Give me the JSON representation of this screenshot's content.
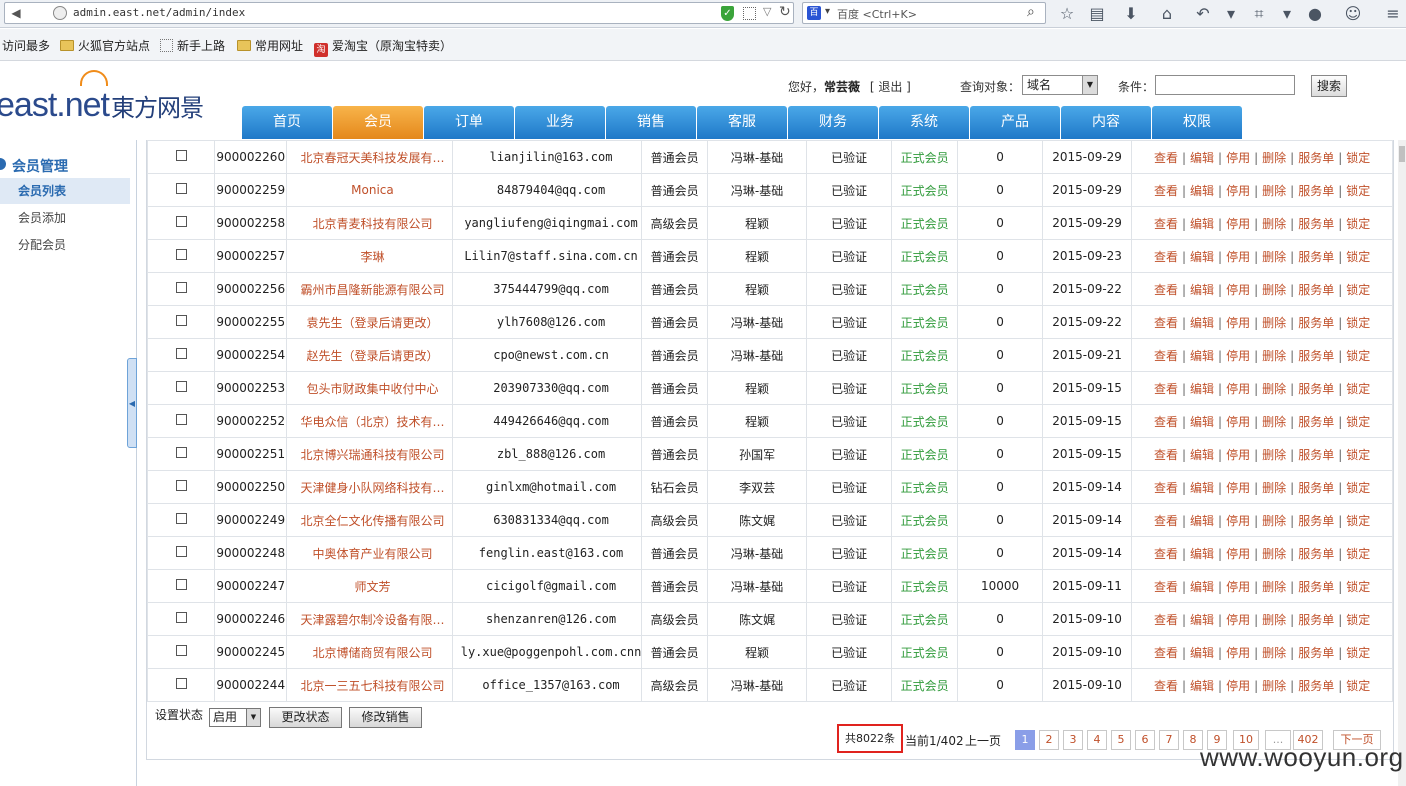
{
  "browser": {
    "url": "admin.east.net/admin/index",
    "search_placeholder": "百度 <Ctrl+K>",
    "bookmarks": [
      "访问最多",
      "火狐官方站点",
      "新手上路",
      "常用网址",
      "爱淘宝（原淘宝特卖）"
    ]
  },
  "header": {
    "logo_text": "east.net",
    "logo_cn": "東方网景",
    "greeting_prefix": "您好，",
    "user_name": "常芸薇",
    "logout": "[ 退出 ]",
    "query_label": "查询对象：",
    "query_value": "域名",
    "cond_label": "条件：",
    "search_button": "搜索"
  },
  "nav": [
    "首页",
    "会员",
    "订单",
    "业务",
    "销售",
    "客服",
    "财务",
    "系统",
    "产品",
    "内容",
    "权限"
  ],
  "nav_active": "会员",
  "sidebar": {
    "title": "会员管理",
    "items": [
      "会员列表",
      "会员添加",
      "分配会员"
    ]
  },
  "ops": [
    "查看",
    "编辑",
    "停用",
    "删除",
    "服务单",
    "锁定"
  ],
  "rows": [
    {
      "id": "900002260",
      "name": "北京春冠天美科技发展有…",
      "email": "lianjilin@163.com",
      "level": "普通会员",
      "sales": "冯琳-基础",
      "verified": "已验证",
      "status": "正式会员",
      "num": "0",
      "date": "2015-09-29"
    },
    {
      "id": "900002259",
      "name": "Monica",
      "email": "84879404@qq.com",
      "level": "普通会员",
      "sales": "冯琳-基础",
      "verified": "已验证",
      "status": "正式会员",
      "num": "0",
      "date": "2015-09-29"
    },
    {
      "id": "900002258",
      "name": "北京青麦科技有限公司",
      "email": "yangliufeng@iqingmai.com",
      "level": "高级会员",
      "sales": "程颖",
      "verified": "已验证",
      "status": "正式会员",
      "num": "0",
      "date": "2015-09-29"
    },
    {
      "id": "900002257",
      "name": "李琳",
      "email": "Lilin7@staff.sina.com.cn",
      "level": "普通会员",
      "sales": "程颖",
      "verified": "已验证",
      "status": "正式会员",
      "num": "0",
      "date": "2015-09-23"
    },
    {
      "id": "900002256",
      "name": "霸州市昌隆新能源有限公司",
      "email": "375444799@qq.com",
      "level": "普通会员",
      "sales": "程颖",
      "verified": "已验证",
      "status": "正式会员",
      "num": "0",
      "date": "2015-09-22"
    },
    {
      "id": "900002255",
      "name": "袁先生（登录后请更改）",
      "email": "ylh7608@126.com",
      "level": "普通会员",
      "sales": "冯琳-基础",
      "verified": "已验证",
      "status": "正式会员",
      "num": "0",
      "date": "2015-09-22"
    },
    {
      "id": "900002254",
      "name": "赵先生（登录后请更改）",
      "email": "cpo@newst.com.cn",
      "level": "普通会员",
      "sales": "冯琳-基础",
      "verified": "已验证",
      "status": "正式会员",
      "num": "0",
      "date": "2015-09-21"
    },
    {
      "id": "900002253",
      "name": "包头市财政集中收付中心",
      "email": "203907330@qq.com",
      "level": "普通会员",
      "sales": "程颖",
      "verified": "已验证",
      "status": "正式会员",
      "num": "0",
      "date": "2015-09-15"
    },
    {
      "id": "900002252",
      "name": "华电众信（北京）技术有…",
      "email": "449426646@qq.com",
      "level": "普通会员",
      "sales": "程颖",
      "verified": "已验证",
      "status": "正式会员",
      "num": "0",
      "date": "2015-09-15"
    },
    {
      "id": "900002251",
      "name": "北京博兴瑞通科技有限公司",
      "email": "zbl_888@126.com",
      "level": "普通会员",
      "sales": "孙国军",
      "verified": "已验证",
      "status": "正式会员",
      "num": "0",
      "date": "2015-09-15"
    },
    {
      "id": "900002250",
      "name": "天津健身小队网络科技有…",
      "email": "ginlxm@hotmail.com",
      "level": "钻石会员",
      "sales": "李双芸",
      "verified": "已验证",
      "status": "正式会员",
      "num": "0",
      "date": "2015-09-14"
    },
    {
      "id": "900002249",
      "name": "北京全仁文化传播有限公司",
      "email": "630831334@qq.com",
      "level": "高级会员",
      "sales": "陈文娓",
      "verified": "已验证",
      "status": "正式会员",
      "num": "0",
      "date": "2015-09-14"
    },
    {
      "id": "900002248",
      "name": "中奥体育产业有限公司",
      "email": "fenglin.east@163.com",
      "level": "普通会员",
      "sales": "冯琳-基础",
      "verified": "已验证",
      "status": "正式会员",
      "num": "0",
      "date": "2015-09-14"
    },
    {
      "id": "900002247",
      "name": "师文芳",
      "email": "cicigolf@gmail.com",
      "level": "普通会员",
      "sales": "冯琳-基础",
      "verified": "已验证",
      "status": "正式会员",
      "num": "10000",
      "date": "2015-09-11"
    },
    {
      "id": "900002246",
      "name": "天津露碧尔制冷设备有限…",
      "email": "shenzanren@126.com",
      "level": "高级会员",
      "sales": "陈文娓",
      "verified": "已验证",
      "status": "正式会员",
      "num": "0",
      "date": "2015-09-10"
    },
    {
      "id": "900002245",
      "name": "北京博储商贸有限公司",
      "email": "ly.xue@poggenpohl.com.cnn",
      "level": "普通会员",
      "sales": "程颖",
      "verified": "已验证",
      "status": "正式会员",
      "num": "0",
      "date": "2015-09-10"
    },
    {
      "id": "900002244",
      "name": "北京一三五七科技有限公司",
      "email": "office_1357@163.com",
      "level": "高级会员",
      "sales": "冯琳-基础",
      "verified": "已验证",
      "status": "正式会员",
      "num": "0",
      "date": "2015-09-10"
    }
  ],
  "tools": {
    "set_status_label": "设置状态",
    "status_value": "启用",
    "change_status": "更改状态",
    "change_sales": "修改销售"
  },
  "pager": {
    "total": "共8022条",
    "current": "当前1/402",
    "prev": "上一页",
    "pages": [
      "1",
      "2",
      "3",
      "4",
      "5",
      "6",
      "7",
      "8",
      "9",
      "10",
      "...",
      "402"
    ],
    "next": "下一页"
  },
  "watermark": "www.wooyun.org",
  "colors": {
    "accent": "#e4881c",
    "nav": "#1f78c8",
    "link": "#c0502a",
    "status_green": "#2f9a3a",
    "highlight": "#e0231e"
  }
}
